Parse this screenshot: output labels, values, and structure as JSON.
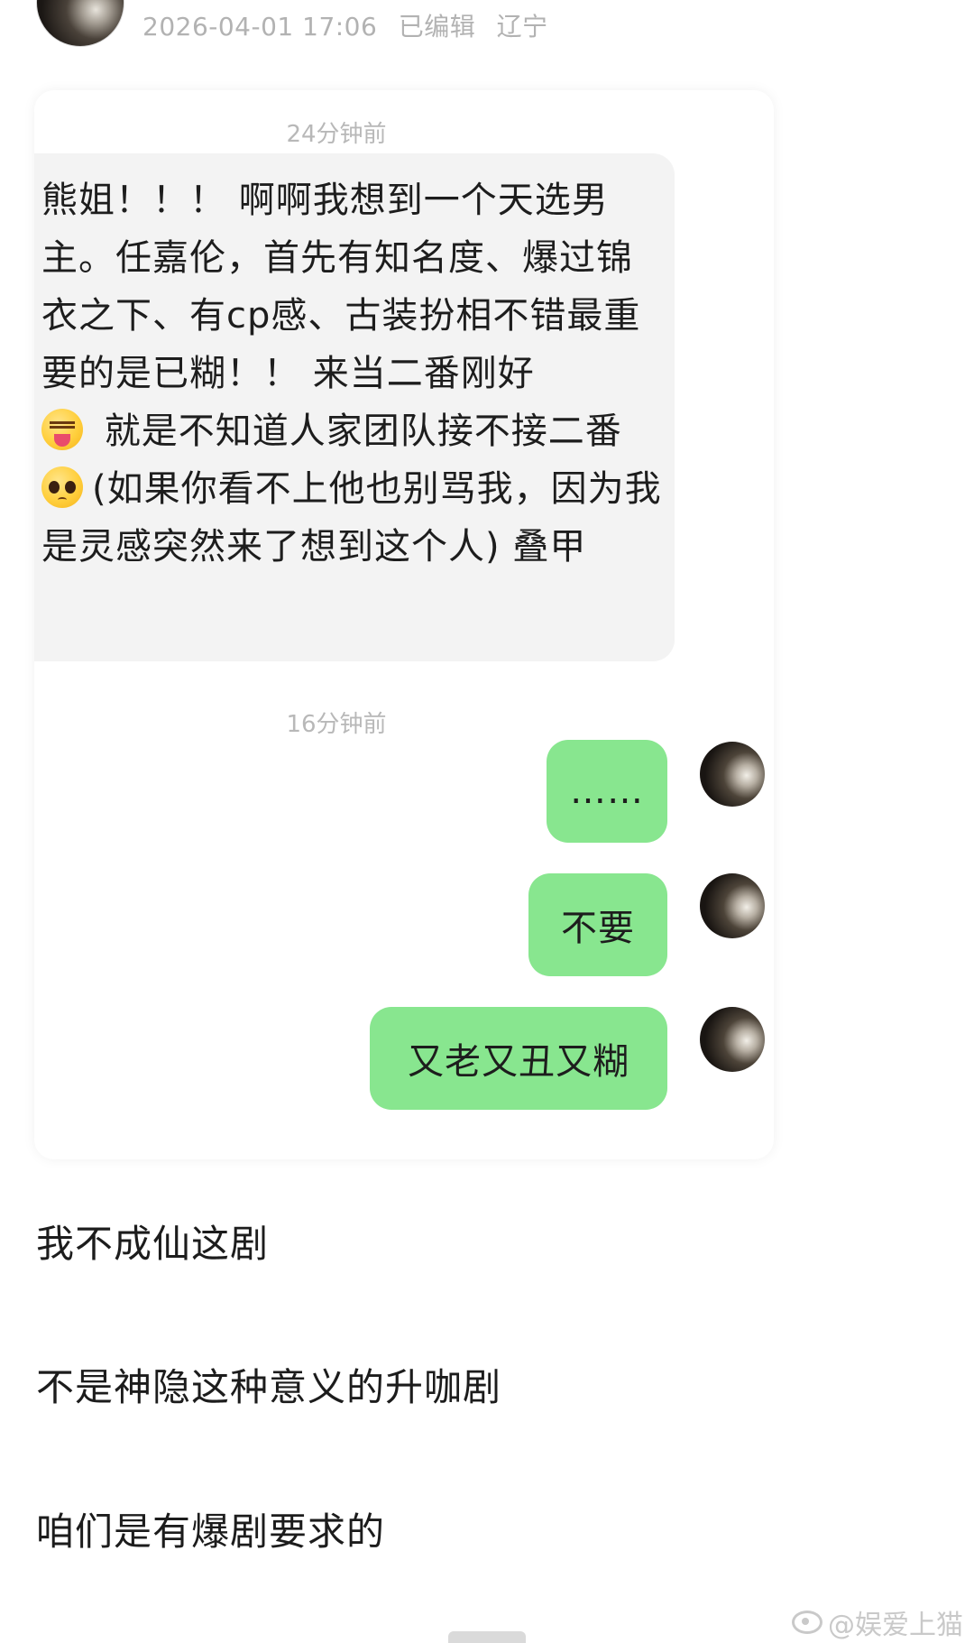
{
  "post": {
    "timestamp": "2026-04-01 17:06",
    "edited": "已编辑",
    "location": "辽宁"
  },
  "chat": {
    "time_1": "24分钟前",
    "incoming": {
      "part1": "熊姐！！！ 啊啊我想到一个天选男主。任嘉伦，首先有知名度、爆过锦衣之下、有cp感、古装扮相不错最重要的是已糊！！ 来当二番刚好",
      "emoji1": "squinting-tongue-emoji",
      "part2": " 就是不知道人家团队接不接二番",
      "emoji2": "pleading-face-emoji",
      "part3": "(如果你看不上他也别骂我，因为我是灵感突然来了想到这个人) 叠甲"
    },
    "time_2": "16分钟前",
    "outgoing": [
      {
        "text": "……"
      },
      {
        "text": "不要"
      },
      {
        "text": "又老又丑又糊"
      }
    ]
  },
  "paragraphs": [
    "我不成仙这剧",
    "不是神隐这种意义的升咖剧",
    "咱们是有爆剧要求的"
  ],
  "watermark": {
    "icon": "weibo-icon",
    "text": "@娱爱上猫"
  }
}
